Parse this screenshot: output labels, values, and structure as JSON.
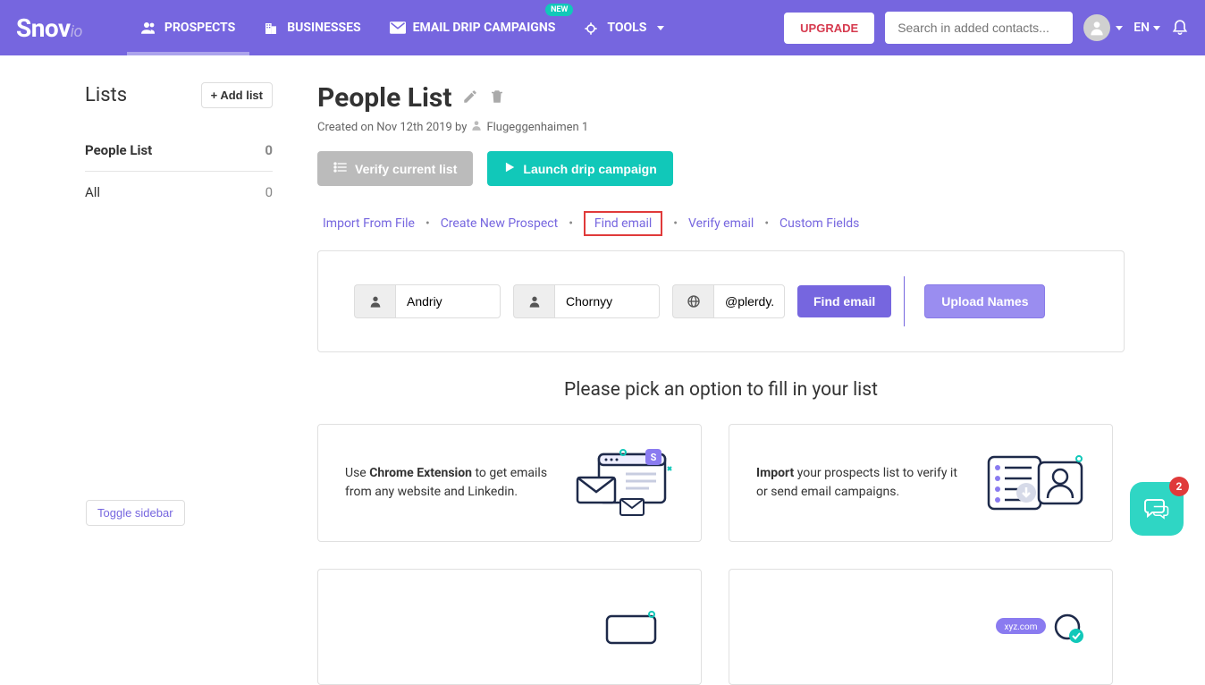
{
  "header": {
    "logo_main": "Snov",
    "logo_sub": "io",
    "nav": {
      "prospects": "PROSPECTS",
      "businesses": "BUSINESSES",
      "campaigns": "EMAIL DRIP CAMPAIGNS",
      "campaigns_badge": "NEW",
      "tools": "TOOLS"
    },
    "upgrade": "UPGRADE",
    "search_placeholder": "Search in added contacts...",
    "lang": "EN"
  },
  "sidebar": {
    "title": "Lists",
    "add_label": "+ Add list",
    "items": [
      {
        "name": "People List",
        "count": "0"
      },
      {
        "name": "All",
        "count": "0"
      }
    ],
    "toggle": "Toggle sidebar"
  },
  "main": {
    "title": "People List",
    "meta_prefix": "Created on Nov 12th 2019 by",
    "meta_user": "Flugeggenhaimen 1",
    "verify_btn": "Verify current list",
    "launch_btn": "Launch drip campaign",
    "tabs": {
      "import": "Import From File",
      "create": "Create New Prospect",
      "find": "Find email",
      "verify": "Verify email",
      "custom": "Custom Fields"
    },
    "form": {
      "first_name": "Andriy",
      "last_name": "Chornyy",
      "domain": "@plerdy.com",
      "find_btn": "Find email",
      "upload_btn": "Upload Names"
    },
    "prompt": "Please pick an option to fill in your list",
    "cards": {
      "c1_pre": "Use ",
      "c1_bold": "Chrome Extension",
      "c1_post": " to get emails from any website and Linkedin.",
      "c2_bold": "Import",
      "c2_post": " your prospects list to verify it or send email campaigns."
    }
  },
  "chat": {
    "count": "2"
  }
}
